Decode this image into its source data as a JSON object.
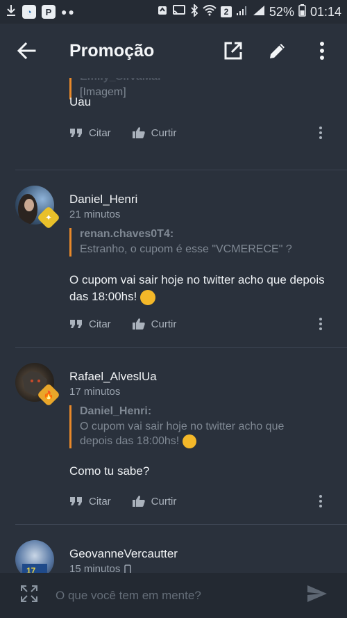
{
  "status": {
    "battery": "52%",
    "time": "01:14",
    "sim_badge": "2"
  },
  "appbar": {
    "title": "Promoção"
  },
  "posts": [
    {
      "quote_author": "Emily_SilVaMai",
      "quote_text": "[Imagem]",
      "body": "Uau",
      "quote_label": "Citar",
      "like_label": "Curtir"
    },
    {
      "author": "Daniel_Henri",
      "time": "21 minutos",
      "quote_author": "renan.chaves0T4:",
      "quote_text": "Estranho, o cupom é esse \"VCMERECE\" ?",
      "body": "O cupom vai sair hoje no twitter acho que depois das 18:00hs!",
      "quote_label": "Citar",
      "like_label": "Curtir"
    },
    {
      "author": "Rafael_AlveslUa",
      "time": "17 minutos",
      "quote_author": "Daniel_Henri:",
      "quote_text": "O cupom vai sair hoje no twitter acho que depois das 18:00hs!",
      "body": "Como tu sabe?",
      "quote_label": "Citar",
      "like_label": "Curtir"
    },
    {
      "author": "GeovanneVercautter",
      "time": "15 minutos"
    }
  ],
  "composer": {
    "placeholder": "O que você tem em mente?"
  }
}
